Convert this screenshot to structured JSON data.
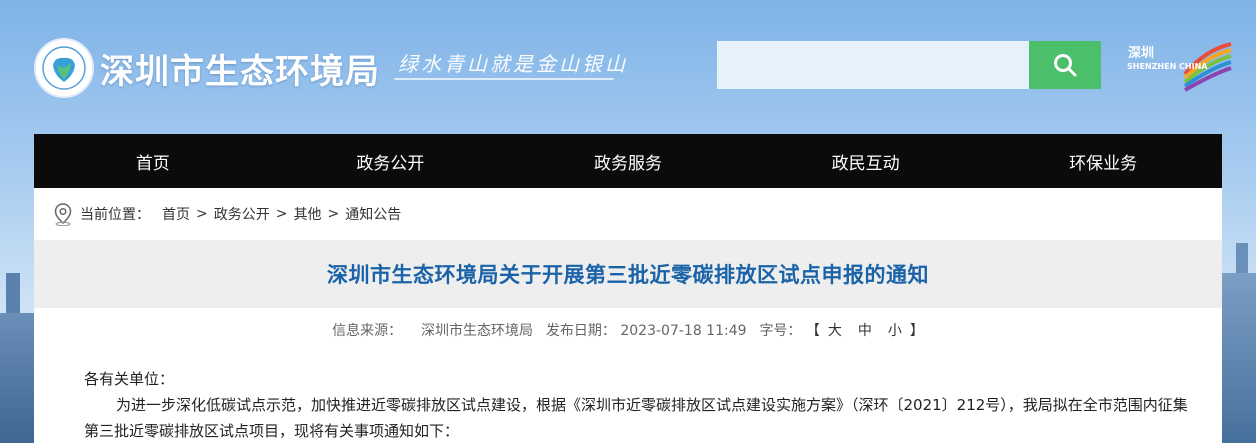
{
  "header": {
    "site_name": "深圳市生态环境局",
    "slogan": "绿水青山就是金山银山",
    "search": {
      "placeholder": ""
    },
    "city_logo": {
      "cn": "深圳",
      "en": "SHENZHEN CHINA"
    }
  },
  "nav": {
    "items": [
      "首页",
      "政务公开",
      "政务服务",
      "政民互动",
      "环保业务"
    ]
  },
  "breadcrumb": {
    "prefix": "当前位置：",
    "items": [
      "首页",
      "政务公开",
      "其他",
      "通知公告"
    ],
    "separator": ">"
  },
  "article": {
    "title": "深圳市生态环境局关于开展第三批近零碳排放区试点申报的通知",
    "meta": {
      "source_label": "信息来源：",
      "source": "深圳市生态环境局",
      "date_label": "发布日期：",
      "date": "2023-07-18 11:49",
      "fontsize_label": "字号：",
      "bracket_open": "【",
      "bracket_close": "】",
      "sizes": [
        "大",
        "中",
        "小"
      ]
    },
    "salutation": "各有关单位：",
    "paragraph": "为进一步深化低碳试点示范，加快推进近零碳排放区试点建设，根据《深圳市近零碳排放区试点建设实施方案》（深环〔2021〕212号），我局拟在全市范围内征集第三批近零碳排放区试点项目，现将有关事项通知如下："
  },
  "colors": {
    "nav_bg": "#0b0b0b",
    "title_color": "#1a63a8",
    "search_button": "#4cbf6b"
  },
  "icons": [
    "search-icon",
    "location-pin-icon",
    "bureau-logo-icon",
    "shenzhen-logo-icon"
  ]
}
